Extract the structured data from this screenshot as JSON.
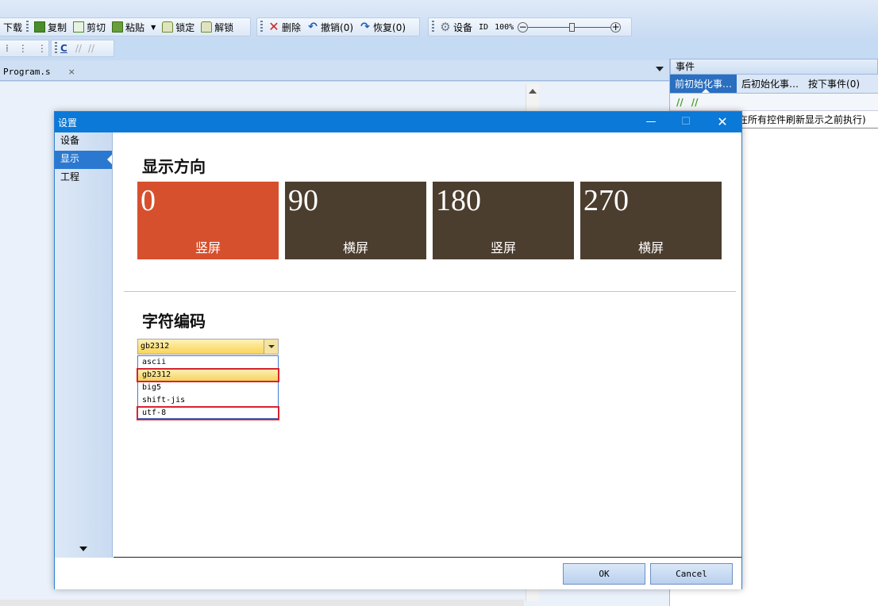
{
  "toolbar": {
    "row1": {
      "download_fragment": "下载",
      "copy": "复制",
      "cut": "剪切",
      "paste": "粘贴",
      "lock": "锁定",
      "unlock": "解锁",
      "delete": "删除",
      "undo": "撤销(0)",
      "redo": "恢复(0)",
      "settings": "设备",
      "id": "ID",
      "zoom": "100%"
    },
    "row2": {
      "c_label": "C"
    }
  },
  "editor": {
    "tab_label": "Program.s",
    "tab_close": "×"
  },
  "events_panel": {
    "title": "事件",
    "tabs": [
      "前初始化事…",
      "后初始化事…",
      "按下事件(0)"
    ],
    "description": "在所有控件刷新显示之前执行)"
  },
  "dialog": {
    "title": "设置",
    "controls": {
      "minimize": "—",
      "maximize": "☐",
      "close": "✕"
    },
    "nav": [
      "设备",
      "显示",
      "工程"
    ],
    "orientation": {
      "title": "显示方向",
      "selected_index": 0,
      "tiles": [
        {
          "value": "0",
          "label": "竖屏"
        },
        {
          "value": "90",
          "label": "横屏"
        },
        {
          "value": "180",
          "label": "竖屏"
        },
        {
          "value": "270",
          "label": "横屏"
        }
      ]
    },
    "encoding": {
      "title": "字符编码",
      "selected": "gb2312",
      "options": [
        "ascii",
        "gb2312",
        "big5",
        "shift-jis",
        "utf-8"
      ]
    },
    "buttons": {
      "ok": "OK",
      "cancel": "Cancel"
    }
  },
  "colors": {
    "tile_selected": "#d6502e",
    "tile_normal": "#4c3e2f",
    "title_bar": "#0a79d8",
    "highlight_box": "#d9232f"
  }
}
